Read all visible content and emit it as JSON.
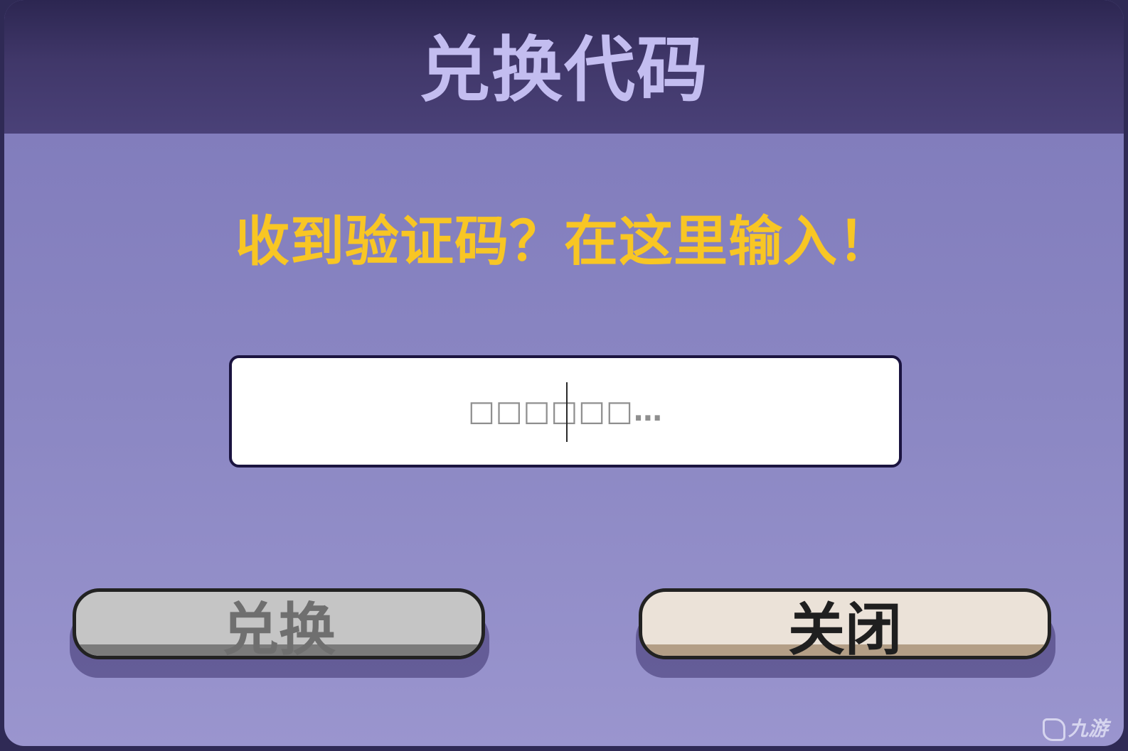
{
  "dialog": {
    "title": "兑换代码",
    "prompt": "收到验证码？在这里输入！",
    "code_input": {
      "value": "",
      "placeholder": "□□□□□□…"
    },
    "buttons": {
      "redeem_label": "兑换",
      "close_label": "关闭"
    }
  },
  "watermark": {
    "text": "九游"
  },
  "colors": {
    "title": "#c3bdf0",
    "prompt": "#f8c624",
    "panel": "#8b87c3",
    "header": "#403769",
    "redeem_button": "#c5c5c5",
    "close_button": "#ebe2d8"
  }
}
